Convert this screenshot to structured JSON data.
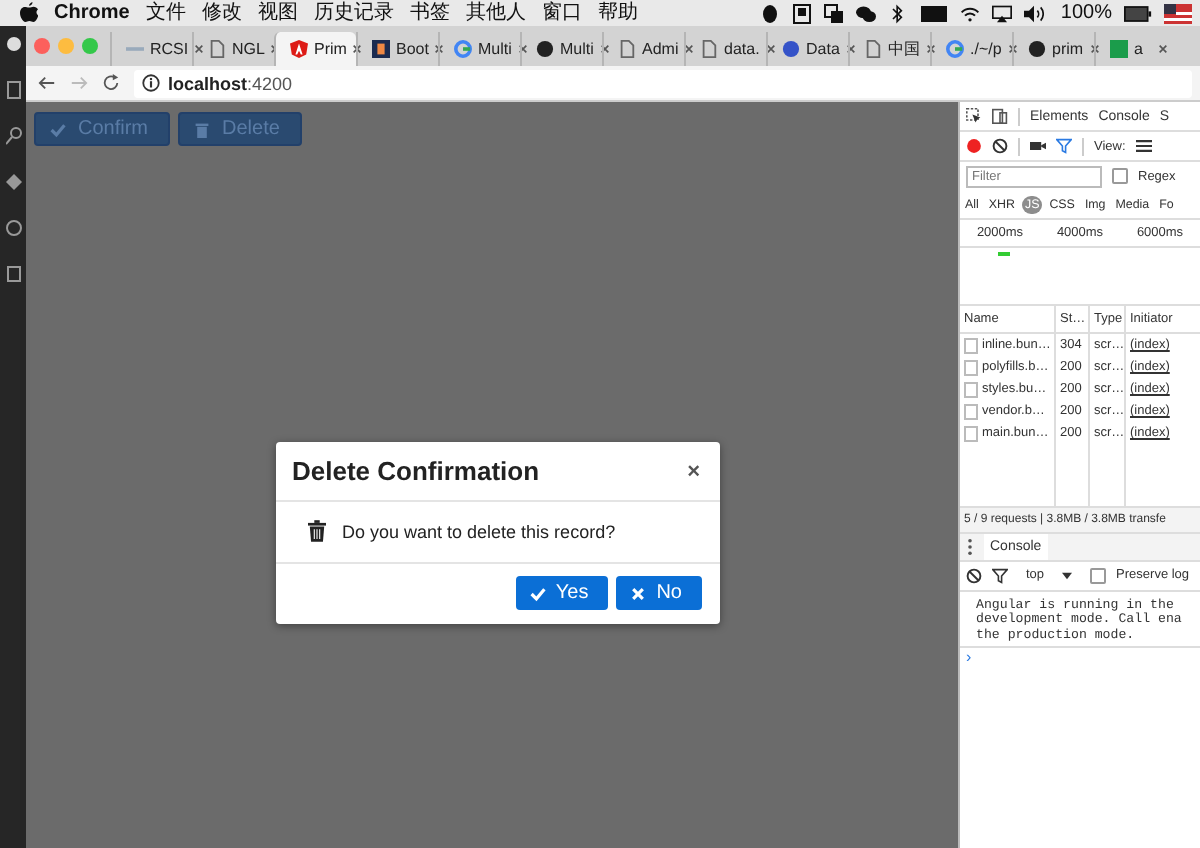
{
  "menubar": {
    "app": "Chrome",
    "menus": [
      "文件",
      "修改",
      "视图",
      "历史记录",
      "书签",
      "其他人",
      "窗口",
      "帮助"
    ],
    "battery": "100%"
  },
  "browser": {
    "tabs": [
      {
        "label": "RCSI",
        "kind": "dash",
        "selected": false
      },
      {
        "label": "NGL",
        "kind": "doc",
        "selected": false
      },
      {
        "label": "Prim",
        "kind": "angular",
        "selected": true
      },
      {
        "label": "Boot",
        "kind": "boot",
        "selected": false
      },
      {
        "label": "Multi",
        "kind": "google",
        "selected": false
      },
      {
        "label": "Multi",
        "kind": "github",
        "selected": false
      },
      {
        "label": "Admi",
        "kind": "doc",
        "selected": false
      },
      {
        "label": "data.",
        "kind": "doc",
        "selected": false
      },
      {
        "label": "Data",
        "kind": "globe",
        "selected": false
      },
      {
        "label": "中国",
        "kind": "doc",
        "selected": false
      },
      {
        "label": "./~/p",
        "kind": "google",
        "selected": false
      },
      {
        "label": "prim",
        "kind": "github",
        "selected": false
      },
      {
        "label": "a",
        "kind": "sf",
        "selected": false
      }
    ],
    "url_host": "localhost",
    "url_port": ":4200"
  },
  "page": {
    "buttons": [
      {
        "label": "Confirm",
        "kind": "check"
      },
      {
        "label": "Delete",
        "kind": "trash"
      }
    ],
    "dialog": {
      "title": "Delete Confirmation",
      "close": "×",
      "message": "Do you want to delete this record?",
      "buttons": [
        {
          "label": "Yes",
          "kind": "check"
        },
        {
          "label": "No",
          "kind": "times"
        }
      ]
    }
  },
  "devtools": {
    "panels": [
      "Elements",
      "Console",
      "S"
    ],
    "view_label": "View:",
    "filter_placeholder": "Filter",
    "regex": {
      "label": "Regex",
      "checked": false
    },
    "types": [
      {
        "label": "All",
        "selected": false
      },
      {
        "label": "XHR",
        "selected": false
      },
      {
        "label": "JS",
        "selected": true
      },
      {
        "label": "CSS",
        "selected": false
      },
      {
        "label": "Img",
        "selected": false
      },
      {
        "label": "Media",
        "selected": false
      },
      {
        "label": "Fo",
        "selected": false
      }
    ],
    "ticks": [
      "2000ms",
      "4000ms",
      "6000ms"
    ],
    "columns": [
      "Name",
      "St…",
      "Type",
      "Initiator"
    ],
    "rows": [
      {
        "name": "inline.bun…",
        "status": "304",
        "type": "scr…",
        "initiator": "(index)"
      },
      {
        "name": "polyfills.b…",
        "status": "200",
        "type": "scr…",
        "initiator": "(index)"
      },
      {
        "name": "styles.bu…",
        "status": "200",
        "type": "scr…",
        "initiator": "(index)"
      },
      {
        "name": "vendor.b…",
        "status": "200",
        "type": "scr…",
        "initiator": "(index)"
      },
      {
        "name": "main.bun…",
        "status": "200",
        "type": "scr…",
        "initiator": "(index)"
      }
    ],
    "summary": "5 / 9 requests | 3.8MB / 3.8MB transfe",
    "drawer_tab": "Console",
    "context": "top",
    "preserve_log": {
      "label": "Preserve log",
      "checked": false
    },
    "console_lines": [
      "Angular is running in the",
      "development mode. Call ena",
      "the production mode."
    ],
    "prompt": "›"
  }
}
